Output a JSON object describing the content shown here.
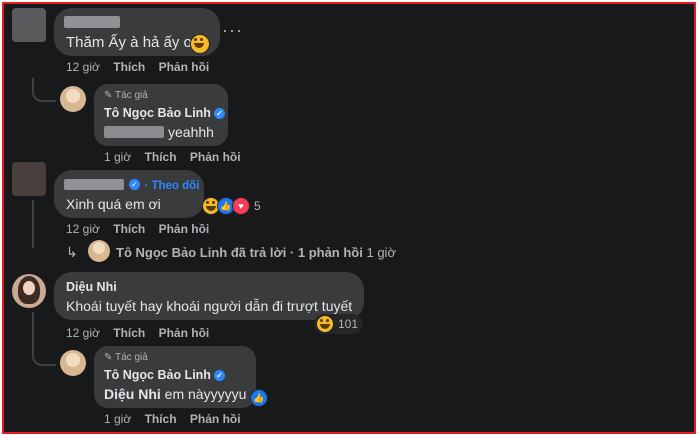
{
  "actions": {
    "like": "Thích",
    "reply": "Phản hồi"
  },
  "comments": [
    {
      "text": "Thăm Ấy à hả ấy ơi",
      "time": "12 giờ"
    },
    {
      "follow": "Theo dõi",
      "text": "Xinh quá em ơi",
      "reactions": "5",
      "time": "12 giờ",
      "replied_summary": "Tô Ngọc Bảo Linh đã trả lời · 1 phản hồi",
      "replied_time": "1 giờ"
    },
    {
      "author": "Diệu Nhi",
      "text": "Khoái tuyết hay khoái người dẫn đi trượt tuyết",
      "reactions": "101",
      "time": "12 giờ"
    }
  ],
  "replies": [
    {
      "badge": "Tác giả",
      "author": "Tô Ngọc Bảo Linh",
      "text": "yeahhh",
      "time": "1 giờ"
    },
    {
      "badge": "Tác giả",
      "author": "Tô Ngọc Bảo Linh",
      "mention": "Diệu Nhi",
      "text": "em nàyyyyyu",
      "time": "1 giờ"
    }
  ],
  "colors": {
    "background": "#18191a",
    "bubble": "#3a3b3c",
    "accent": "#2d88ff",
    "frame_border": "#e41b23"
  }
}
